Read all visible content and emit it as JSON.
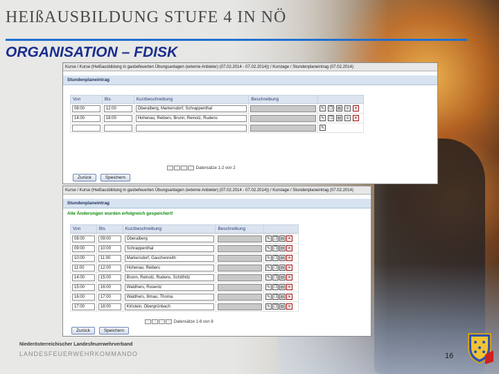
{
  "slide": {
    "title": "HEIßAUSBILDUNG STUFE 4 IN NÖ",
    "subtitle": "ORGANISATION – FDISK",
    "footer_org_line1": "Niederösterreichischer Landesfeuerwehrverband",
    "footer_org_line2": "LANDESFEUERWEHRKOMMANDO",
    "page_number": "16",
    "accent_color": "#1e6fd1",
    "subtitle_color": "#1a2d8f"
  },
  "screenshot1": {
    "breadcrumb": "Kurse / Kurse (Heißausbildung in gasbefeuerten Übungsanlagen (externe Anbieter) (07.02.2014 - 07.02.2014)) / Kurstage / Stundenplaneintrag (07.02.2014)",
    "section_title": "Stundenplaneintrag",
    "columns": [
      "Von",
      "Bis",
      "Kurzbeschreibung",
      "Beschreibung"
    ],
    "rows": [
      {
        "von": "08:00",
        "bis": "12:00",
        "kurz": "Oberalberg, Markersdorf, Schrappenthal"
      },
      {
        "von": "14:00",
        "bis": "18:00",
        "kurz": "Hohenau, Reibers, Brunn, Reinolz, Rudens"
      }
    ],
    "pager_text": "Datensätze 1-2 von 2",
    "back_button": "Zurück",
    "save_button": "Speichern"
  },
  "screenshot2": {
    "breadcrumb": "Kurse / Kurse (Heißausbildung in gasbefeuerten Übungsanlagen (externe Anbieter) (07.02.2014 - 07.02.2014)) / Kurstage / Stundenplaneintrag (07.02.2014)",
    "section_title": "Stundenplaneintrag",
    "success_message": "Alle Änderungen wurden erfolgreich gespeichert!",
    "columns": [
      "Von",
      "Bis",
      "Kurzbeschreibung",
      "Beschreibung"
    ],
    "rows": [
      {
        "von": "08:00",
        "bis": "09:00",
        "kurz": "Oberalberg"
      },
      {
        "von": "09:00",
        "bis": "10:00",
        "kurz": "Schrappenthal"
      },
      {
        "von": "10:00",
        "bis": "11:00",
        "kurz": "Markersdorf, Gaschenreith"
      },
      {
        "von": "11:00",
        "bis": "12:00",
        "kurz": "Hohenau, Reibers"
      },
      {
        "von": "14:00",
        "bis": "15:00",
        "kurz": "Brunn, Reinolz, Rudens, Schöfnitz"
      },
      {
        "von": "15:00",
        "bis": "16:00",
        "kurz": "Waldhers, Rosentz"
      },
      {
        "von": "16:00",
        "bis": "17:00",
        "kurz": "Waldhers, Illmau, Thoma"
      },
      {
        "von": "17:00",
        "bis": "18:00",
        "kurz": "Kirlstein, Obergrünbach"
      }
    ],
    "pager_text": "Datensätze 1-8 von 8",
    "back_button": "Zurück",
    "save_button": "Speichern"
  }
}
